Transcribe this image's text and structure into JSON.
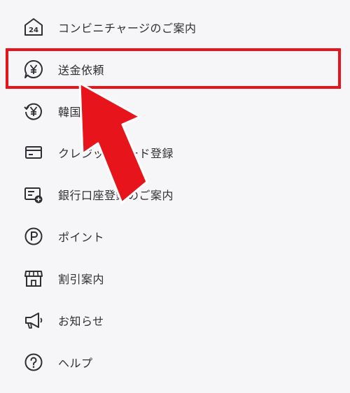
{
  "menu": {
    "items": [
      {
        "label": "コンビニチャージのご案内",
        "icon": "convenience-store-24-icon"
      },
      {
        "label": "送金依頼",
        "icon": "yen-speech-bubble-icon"
      },
      {
        "label": "韓国への送金",
        "icon": "yen-refresh-icon"
      },
      {
        "label": "クレジットカード登録",
        "icon": "credit-card-icon"
      },
      {
        "label": "銀行口座登録のご案内",
        "icon": "bank-card-add-icon"
      },
      {
        "label": "ポイント",
        "icon": "point-p-icon"
      },
      {
        "label": "割引案内",
        "icon": "storefront-icon"
      },
      {
        "label": "お知らせ",
        "icon": "megaphone-icon"
      },
      {
        "label": "ヘルプ",
        "icon": "help-question-icon"
      }
    ]
  },
  "annotation": {
    "highlight_color": "#e8141b",
    "highlighted_item": "送金依頼"
  }
}
